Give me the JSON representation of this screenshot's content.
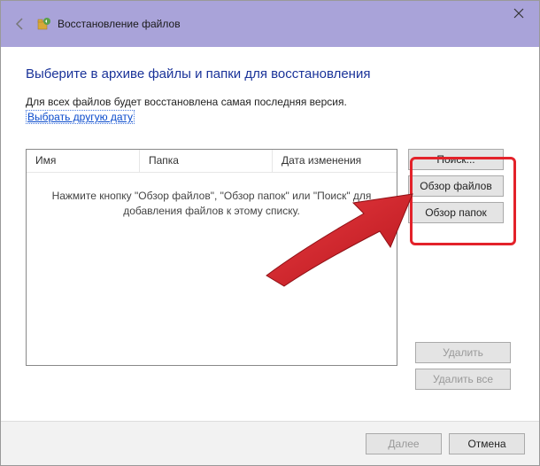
{
  "titlebar": {
    "title": "Восстановление файлов"
  },
  "content": {
    "heading": "Выберите в архиве файлы и папки для восстановления",
    "subtext": "Для всех файлов будет восстановлена самая последняя версия.",
    "link": "Выбрать другую дату"
  },
  "table": {
    "columns": {
      "name": "Имя",
      "folder": "Папка",
      "modified": "Дата изменения"
    },
    "empty_message": "Нажмите кнопку \"Обзор файлов\", \"Обзор папок\" или \"Поиск\" для добавления файлов к этому списку."
  },
  "buttons": {
    "search": "Поиск...",
    "browse_files": "Обзор файлов",
    "browse_folders": "Обзор папок",
    "remove": "Удалить",
    "remove_all": "Удалить все",
    "next": "Далее",
    "cancel": "Отмена"
  }
}
